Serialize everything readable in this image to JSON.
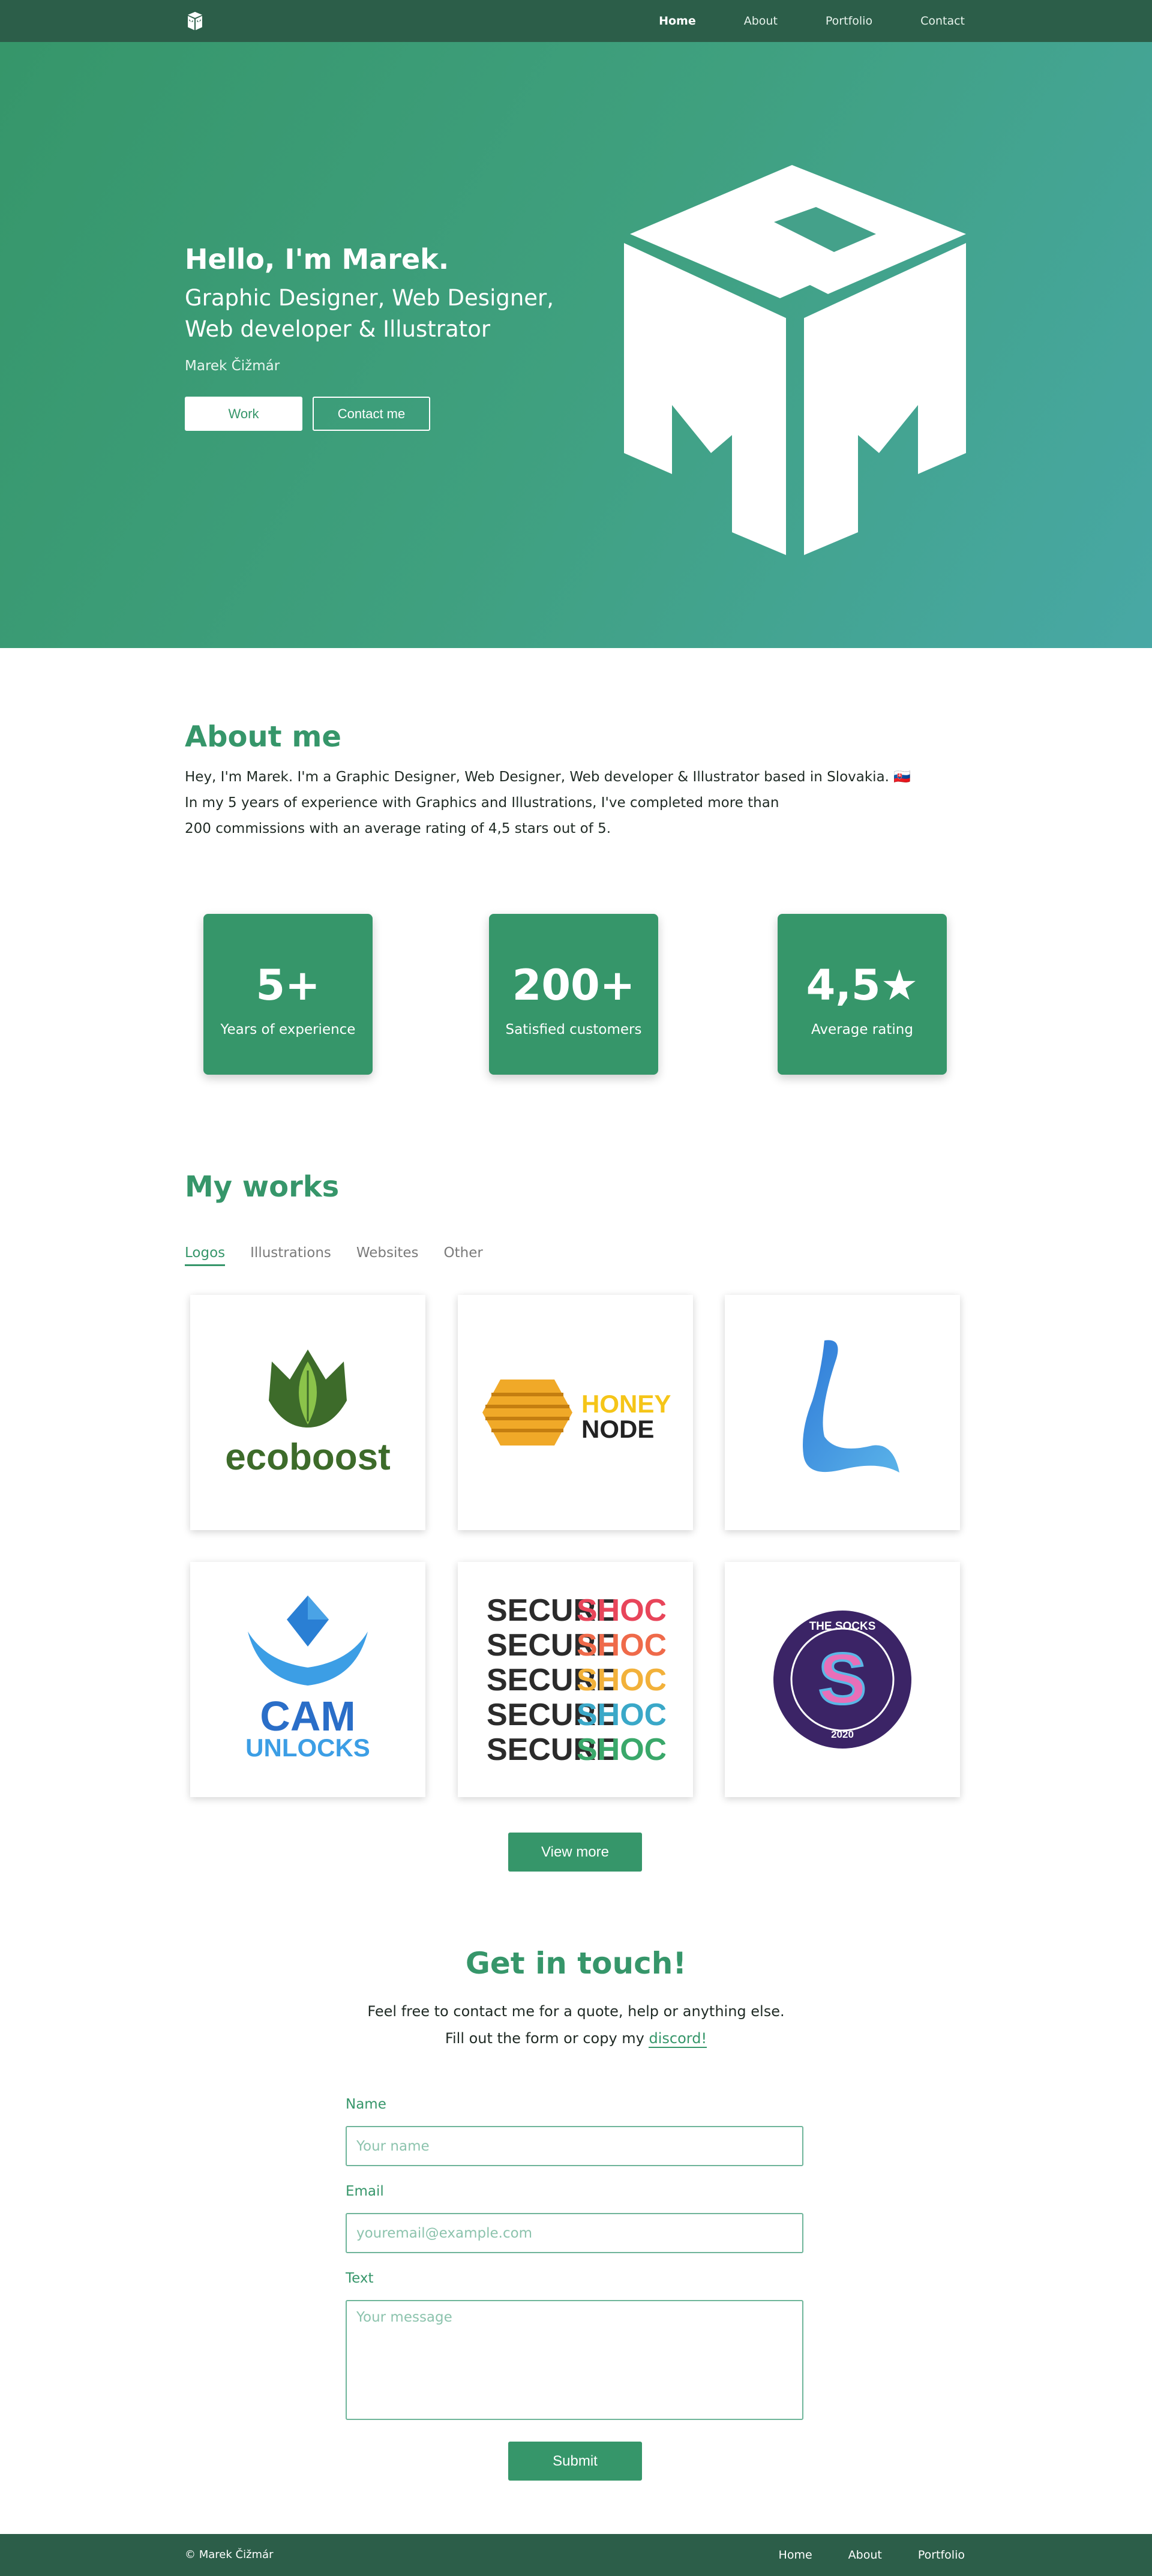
{
  "nav": {
    "logo_icon": "mm-cube-logo-icon",
    "links": [
      {
        "label": "Home",
        "active": true
      },
      {
        "label": "About",
        "active": false
      },
      {
        "label": "Portfolio",
        "active": false
      },
      {
        "label": "Contact",
        "active": false
      }
    ]
  },
  "hero": {
    "title": "Hello, I'm Marek.",
    "subtitle_line1": "Graphic Designer, Web Designer,",
    "subtitle_line2": "Web developer & Illustrator",
    "name": "Marek Čižmár",
    "work_button": "Work",
    "contact_button": "Contact me"
  },
  "about": {
    "title": "About me",
    "line1": "Hey, I'm Marek. I'm a Graphic Designer, Web Designer, Web developer & Illustrator based in Slovakia. 🇸🇰",
    "line2": "In my 5 years of experience with Graphics and Illustrations, I've completed more than",
    "line3": "200 commissions with an average rating of 4,5 stars out of 5."
  },
  "stats": [
    {
      "value": "5+",
      "label": "Years of experience"
    },
    {
      "value": "200+",
      "label": "Satisfied customers"
    },
    {
      "value": "4,5★",
      "label": "Average rating"
    }
  ],
  "works": {
    "title": "My works",
    "tabs": [
      "Logos",
      "Illustrations",
      "Websites",
      "Other"
    ],
    "active_tab": "Logos",
    "cards": [
      {
        "name": "ecoboost",
        "text": "ecoboost"
      },
      {
        "name": "honeynode",
        "text1": "HONEY",
        "text2": "NODE"
      },
      {
        "name": "l-logo"
      },
      {
        "name": "camunlocks",
        "text1": "CAM",
        "text2": "UNLOCKS"
      },
      {
        "name": "secureshock",
        "text1": "SECURE",
        "text2": "SHOCK"
      },
      {
        "name": "thesocks",
        "text1": "THE SOCKS",
        "text2": "2020",
        "letter": "S"
      }
    ],
    "view_more": "View more"
  },
  "contact": {
    "title": "Get in touch!",
    "line1": "Feel free to contact me for a quote, help or anything else.",
    "line2_prefix": "Fill out the form or copy my ",
    "line2_link": "discord!",
    "name_label": "Name",
    "name_placeholder": "Your name",
    "email_label": "Email",
    "email_placeholder": "youremail@example.com",
    "text_label": "Text",
    "text_placeholder": "Your message",
    "submit": "Submit"
  },
  "footer": {
    "copyright": "© Marek Čižmár",
    "links": [
      "Home",
      "About",
      "Portfolio"
    ]
  },
  "colors": {
    "primary": "#36966a",
    "nav_bg": "#2c5e49",
    "hero_start": "#36966a",
    "hero_end": "#48a8a5"
  }
}
